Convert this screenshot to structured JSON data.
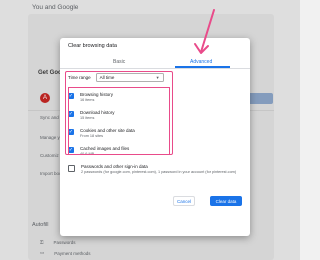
{
  "background": {
    "section_heading": "You and Google",
    "get_google": "Get Goo",
    "avatar_letter": "A",
    "items": [
      "Sync and G",
      "Manage y",
      "Customiz",
      "Import boo"
    ],
    "autofill_heading": "Autofill",
    "autofill_items": [
      "Passwords",
      "Payment methods",
      "Addresses and more"
    ]
  },
  "dialog": {
    "title": "Clear browsing data",
    "tabs": [
      "Basic",
      "Advanced"
    ],
    "active_tab": "Advanced",
    "time_range_label": "Time range",
    "time_range_value": "All time",
    "options": [
      {
        "label": "Browsing history",
        "sub": "16 items",
        "checked": true
      },
      {
        "label": "Download history",
        "sub": "15 items",
        "checked": true
      },
      {
        "label": "Cookies and other site data",
        "sub": "From 18 sites",
        "checked": true
      },
      {
        "label": "Cached images and files",
        "sub": "40.6 MB",
        "checked": true
      },
      {
        "label": "Passwords and other sign-in data",
        "sub": "2 passwords (for google.com, pinterest.com), 1 password in your account (for pinterest.com)",
        "checked": false
      }
    ],
    "cancel_label": "Cancel",
    "clear_label": "Clear data"
  },
  "colors": {
    "accent": "#1a73e8",
    "highlight": "#e94b8a"
  }
}
